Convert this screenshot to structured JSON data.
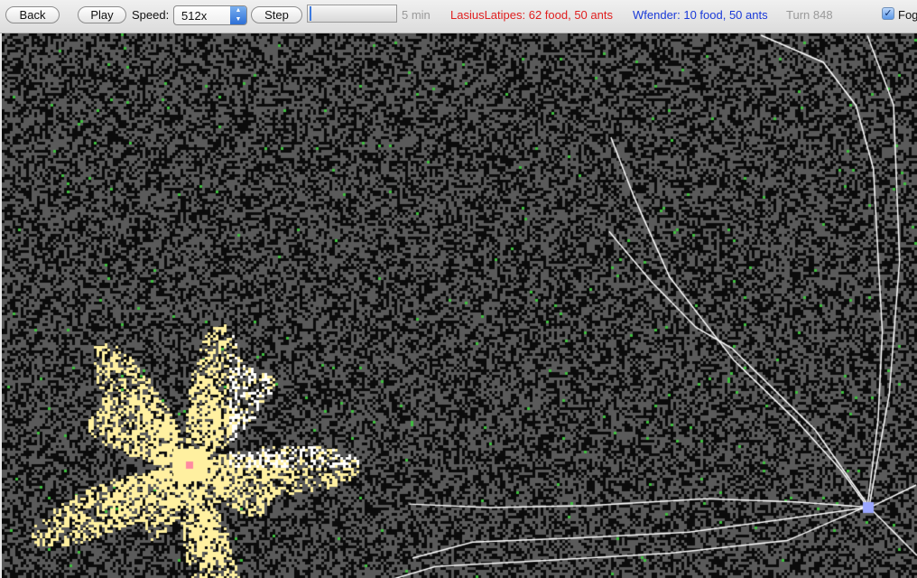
{
  "toolbar": {
    "back_label": "Back",
    "play_label": "Play",
    "speed_label": "Speed:",
    "speed_value": "512x",
    "step_label": "Step",
    "progress": 0.01,
    "time_label": "5 min",
    "team1_status": "LasiusLatipes: 62 food, 50 ants",
    "team2_status": "Wfender: 10 food, 50 ants",
    "turn_label": "Turn 848",
    "fog_label": "Fog",
    "fog_checked": true
  },
  "colors": {
    "team1": "#e02020",
    "team2": "#1a3ad8",
    "explored_team1": "#fff0a0",
    "trails": "#ffffff",
    "food": "#3fbf3f",
    "ground": "#5a5a5a"
  }
}
